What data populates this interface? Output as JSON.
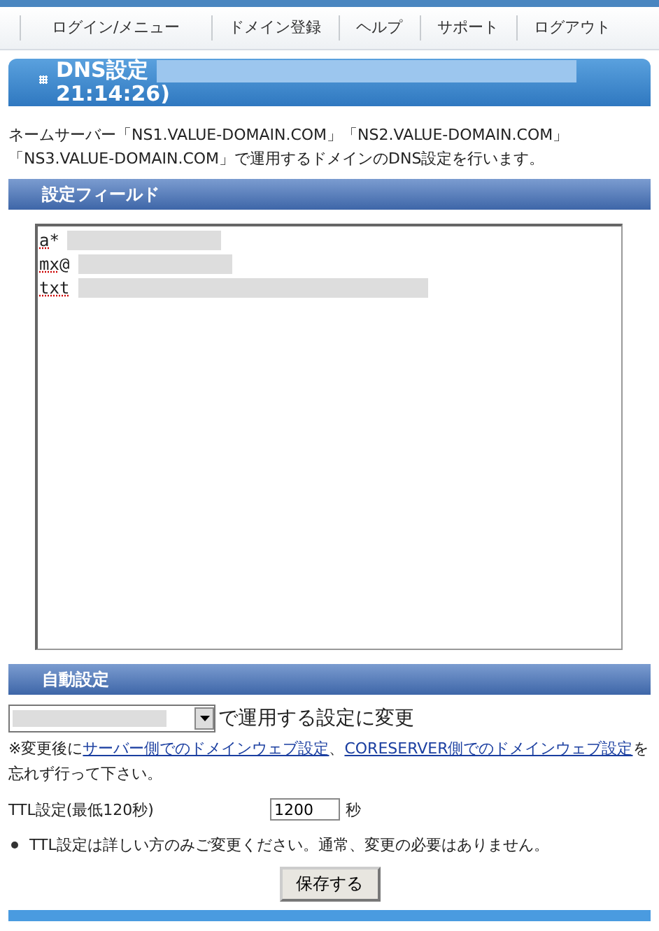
{
  "nav": [
    "ログイン/メニュー",
    "ドメイン登録",
    "ヘルプ",
    "サポート",
    "ログアウト"
  ],
  "title": {
    "text": "DNS設定",
    "time": "21:14:26)"
  },
  "description": "ネームサーバー「NS1.VALUE-DOMAIN.COM」「NS2.VALUE-DOMAIN.COM」「NS3.VALUE-DOMAIN.COM」で運用するドメインのDNS設定を行います。",
  "settings_field": {
    "heading": "設定フィールド",
    "lines": [
      {
        "type": "a",
        "value": "*"
      },
      {
        "type": "mx",
        "value": "@"
      },
      {
        "type": "txt"
      }
    ]
  },
  "auto": {
    "heading": "自動設定",
    "suffix": "で運用する設定に変更",
    "note_before": "※変更後に",
    "link1": "サーバー側でのドメインウェブ設定",
    "sep": "、",
    "link2": "CORESERVER側でのドメインウェブ設定",
    "note_after": "を忘れず行って下さい。"
  },
  "ttl": {
    "label": "TTL設定(最低120秒)",
    "value": "1200",
    "unit": "秒",
    "hint": "TTL設定は詳しい方のみご変更ください。通常、変更の必要はありません。"
  },
  "save_button": "保存する"
}
